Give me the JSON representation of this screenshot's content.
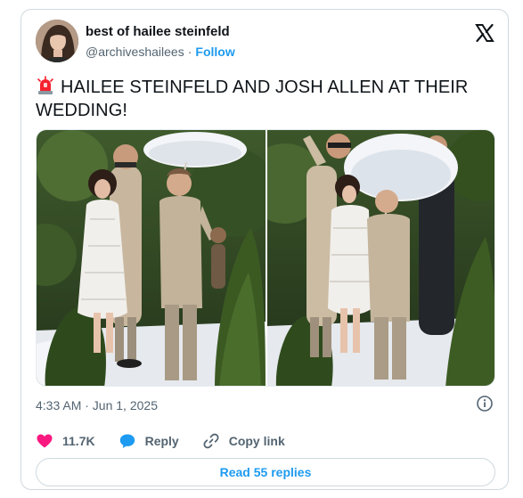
{
  "author": {
    "display_name": "best of hailee steinfeld",
    "handle": "@archiveshailees",
    "separator": "·",
    "follow_label": "Follow"
  },
  "tweet": {
    "emoji_icon": "police-car-light-icon",
    "text": "HAILEE STEINFELD AND JOSH ALLEN AT THEIR WEDDING!"
  },
  "meta": {
    "timestamp": "4:33 AM · Jun 1, 2025"
  },
  "actions": {
    "like_count": "11.7K",
    "reply_label": "Reply",
    "copy_link_label": "Copy link",
    "read_replies_label": "Read 55 replies"
  },
  "colors": {
    "accent": "#1d9bf0",
    "like": "#f91880",
    "muted": "#536471",
    "border": "#cfd9de"
  }
}
